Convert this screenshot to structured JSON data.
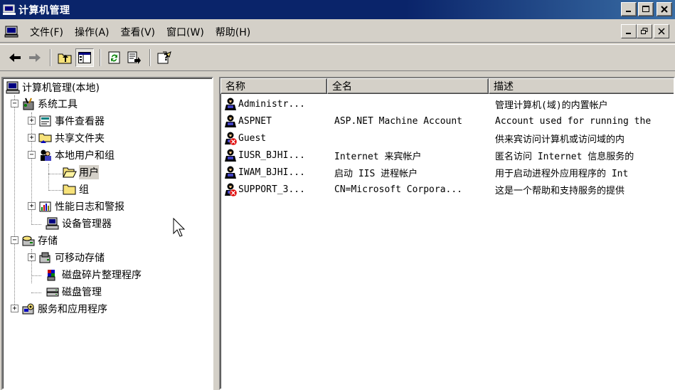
{
  "window": {
    "title": "计算机管理"
  },
  "menu": [
    "文件(F)",
    "操作(A)",
    "查看(V)",
    "窗口(W)",
    "帮助(H)"
  ],
  "toolbar": [
    "back-icon",
    "forward-icon",
    "up-folder-icon",
    "show-hide-tree-icon",
    "refresh-icon",
    "export-list-icon",
    "help-icon"
  ],
  "tree": {
    "root": "计算机管理(本地)",
    "system_tools": "系统工具",
    "event_viewer": "事件查看器",
    "shared_folders": "共享文件夹",
    "local_users": "本地用户和组",
    "users": "用户",
    "groups": "组",
    "perf_logs": "性能日志和警报",
    "device_manager": "设备管理器",
    "storage": "存储",
    "removable_storage": "可移动存储",
    "defrag": "磁盘碎片整理程序",
    "disk_mgmt": "磁盘管理",
    "services_apps": "服务和应用程序"
  },
  "list": {
    "columns": [
      "名称",
      "全名",
      "描述"
    ],
    "rows": [
      {
        "name": "Administr...",
        "fullname": "",
        "desc": "管理计算机(域)的内置帐户",
        "disabled": false
      },
      {
        "name": "ASPNET",
        "fullname": "ASP.NET Machine Account",
        "desc": "Account used for running the",
        "disabled": false
      },
      {
        "name": "Guest",
        "fullname": "",
        "desc": "供来宾访问计算机或访问域的内",
        "disabled": true
      },
      {
        "name": "IUSR_BJHI...",
        "fullname": "Internet 来宾帐户",
        "desc": "匿名访问 Internet 信息服务的",
        "disabled": false
      },
      {
        "name": "IWAM_BJHI...",
        "fullname": "启动 IIS 进程帐户",
        "desc": "用于启动进程外应用程序的 Int",
        "disabled": false
      },
      {
        "name": "SUPPORT_3...",
        "fullname": "CN=Microsoft Corpora...",
        "desc": "这是一个帮助和支持服务的提供",
        "disabled": true
      }
    ]
  }
}
